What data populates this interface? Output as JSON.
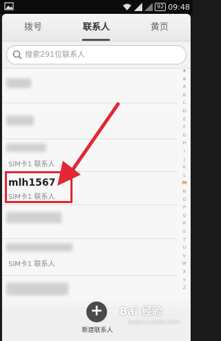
{
  "status": {
    "battery": "92",
    "time": "09:48"
  },
  "tabs": [
    {
      "label": "拨号"
    },
    {
      "label": "联系人"
    },
    {
      "label": "黄页"
    }
  ],
  "search": {
    "placeholder": "搜索291位联系人"
  },
  "contacts": [
    {
      "name": "",
      "sub": ""
    },
    {
      "name": "",
      "sub": ""
    },
    {
      "name": "",
      "sub": "SIM卡1 联系人"
    },
    {
      "name": "mlh1567",
      "sub": "SIM卡1 联系人"
    },
    {
      "name": "",
      "sub": ""
    },
    {
      "name": "",
      "sub": "SIM卡1 联系人"
    },
    {
      "name": "",
      "sub": ""
    }
  ],
  "index_letters": [
    "★",
    "#",
    "A",
    "B",
    "C",
    "D",
    "E",
    "F",
    "G",
    "H",
    "I",
    "J",
    "K",
    "L",
    "M",
    "N",
    "O",
    "P",
    "Q",
    "R",
    "S",
    "T",
    "U",
    "V",
    "W",
    "X",
    "Y",
    "Z"
  ],
  "index_current": "M",
  "add_button": {
    "label": "新建联系人"
  },
  "watermark": {
    "text": "Bai 经验",
    "sub": "jingyan.baidu.com"
  },
  "colors": {
    "highlight": "#e52633",
    "accent_index": "#e08a20"
  }
}
